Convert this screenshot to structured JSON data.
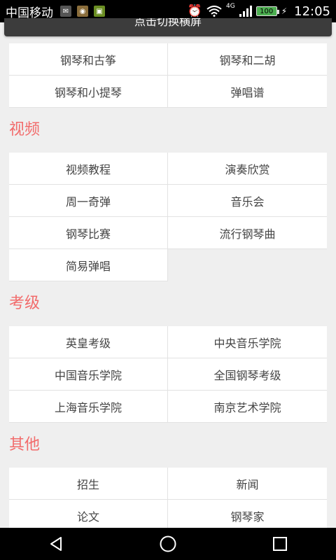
{
  "status_bar": {
    "carrier": "中国移动",
    "network": "4G",
    "battery": "100",
    "time": "12:05"
  },
  "banner": {
    "label": "点击切换横屏"
  },
  "sections": [
    {
      "title": "",
      "items": [
        "钢琴和古筝",
        "钢琴和二胡",
        "钢琴和小提琴",
        "弹唱谱"
      ]
    },
    {
      "title": "视频",
      "items": [
        "视频教程",
        "演奏欣赏",
        "周一奇弹",
        "音乐会",
        "钢琴比赛",
        "流行钢琴曲",
        "简易弹唱"
      ]
    },
    {
      "title": "考级",
      "items": [
        "英皇考级",
        "中央音乐学院",
        "中国音乐学院",
        "全国钢琴考级",
        "上海音乐学院",
        "南京艺术学院"
      ]
    },
    {
      "title": "其他",
      "items": [
        "招生",
        "新闻",
        "论文",
        "钢琴家"
      ]
    }
  ],
  "nav": {
    "back": "back-icon",
    "home": "home-icon",
    "recents": "recents-icon"
  }
}
